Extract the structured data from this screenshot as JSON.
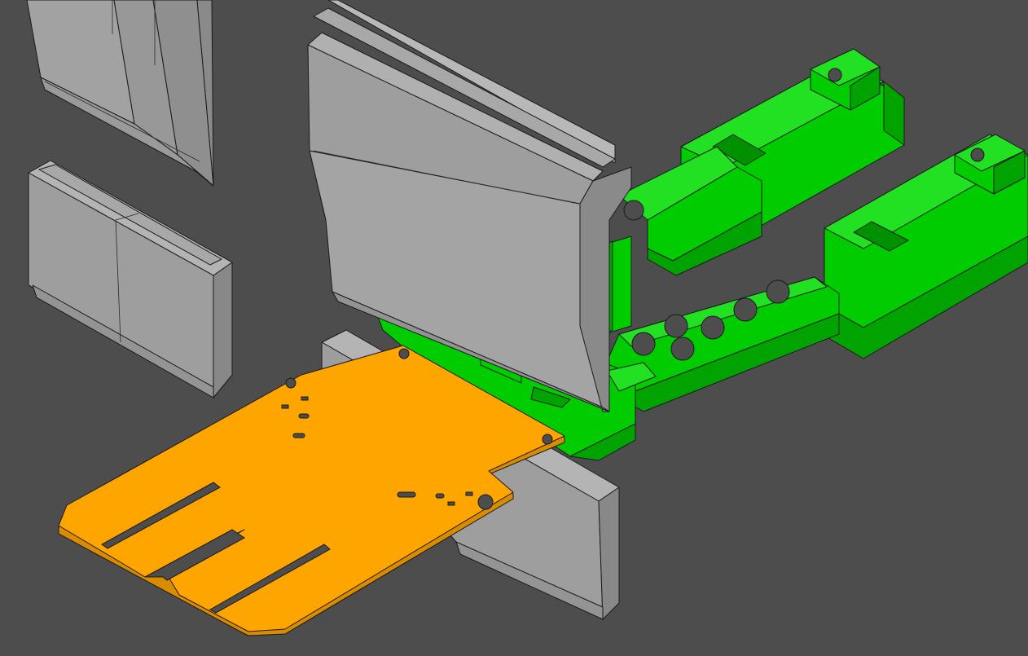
{
  "viewport": {
    "background_color": "#4d4d4d"
  },
  "colors": {
    "tool_face": "#9e9e9e",
    "tool_side": "#8a8a8a",
    "tool_top": "#b4b4b4",
    "gauge_green": "#00cc00",
    "gauge_green_dark": "#00a300",
    "gauge_green_light": "#22e022",
    "sheet_orange": "#ffa500",
    "sheet_orange_dark": "#d98c00",
    "edge_line": "#1a1a1a"
  },
  "scene_parts": [
    {
      "id": "upper-punch-left",
      "icon": "punch-tool-icon"
    },
    {
      "id": "lower-die-left",
      "icon": "die-tool-icon"
    },
    {
      "id": "upper-punch-center",
      "icon": "punch-tool-icon"
    },
    {
      "id": "backgauge-finger-right",
      "icon": "backgauge-icon"
    },
    {
      "id": "backgauge-finger-left",
      "icon": "backgauge-icon"
    },
    {
      "id": "backgauge-crossbar",
      "icon": "backgauge-icon"
    },
    {
      "id": "lower-die-center",
      "icon": "die-tool-icon"
    },
    {
      "id": "sheet-metal-part",
      "icon": "sheet-metal-icon"
    }
  ]
}
